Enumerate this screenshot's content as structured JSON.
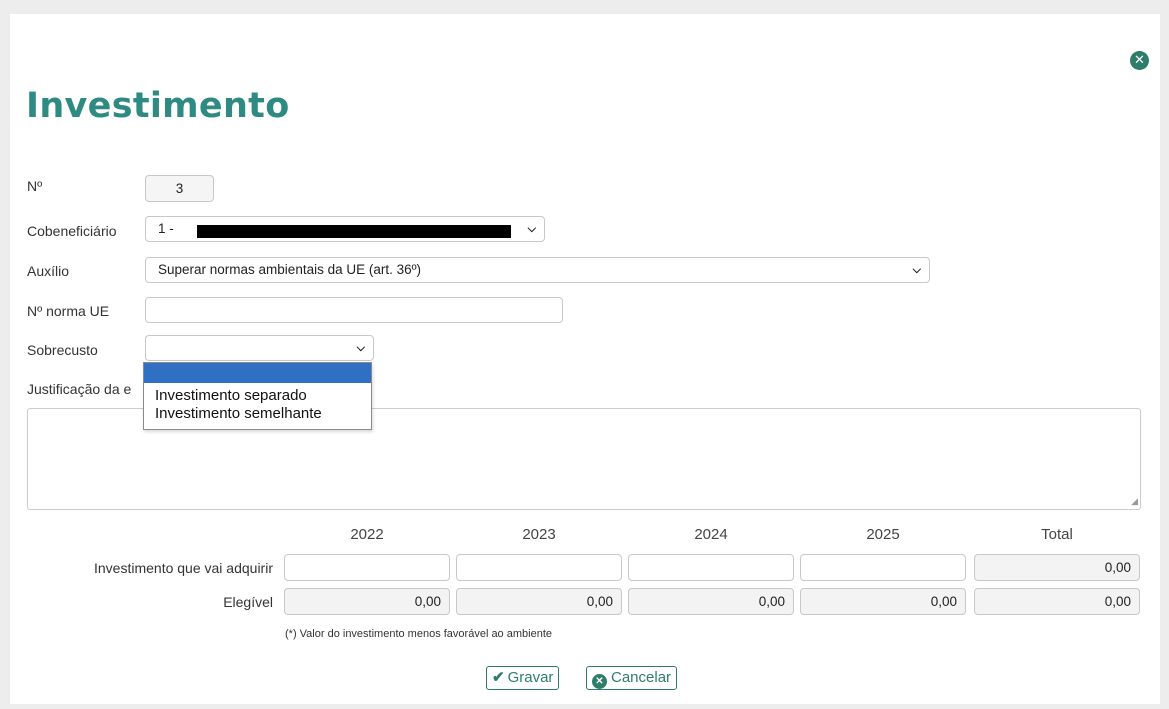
{
  "dialog": {
    "title": "Investimento",
    "close_icon": "close-circle-icon"
  },
  "form": {
    "numero": {
      "label": "Nº",
      "value": "3"
    },
    "cobeneficiario": {
      "label": "Cobeneficiário",
      "value": "1 -",
      "redacted": true
    },
    "auxilio": {
      "label": "Auxílio",
      "value": "Superar normas ambientais da UE (art. 36º)"
    },
    "norma_ue": {
      "label": "Nº norma UE",
      "value": ""
    },
    "sobrecusto": {
      "label": "Sobrecusto",
      "value": "",
      "options": [
        "",
        "Investimento separado",
        "Investimento semelhante"
      ]
    },
    "justificacao": {
      "label": "Justificação da e",
      "value": ""
    }
  },
  "table": {
    "columns": [
      "2022",
      "2023",
      "2024",
      "2025",
      "Total"
    ],
    "rows": [
      {
        "label": "Investimento que vai adquirir",
        "values": [
          "",
          "",
          "",
          "",
          "0,00"
        ]
      },
      {
        "label": "Elegível",
        "values": [
          "0,00",
          "0,00",
          "0,00",
          "0,00",
          "0,00"
        ]
      }
    ],
    "note": "(*) Valor do investimento menos favorável ao ambiente"
  },
  "buttons": {
    "save": {
      "label": "Gravar",
      "icon": "check-icon"
    },
    "cancel": {
      "label": "Cancelar",
      "icon": "close-circle-icon"
    }
  },
  "colors": {
    "accent": "#2e8a82",
    "button": "#2e7d6b",
    "selection": "#2f6fc4"
  }
}
